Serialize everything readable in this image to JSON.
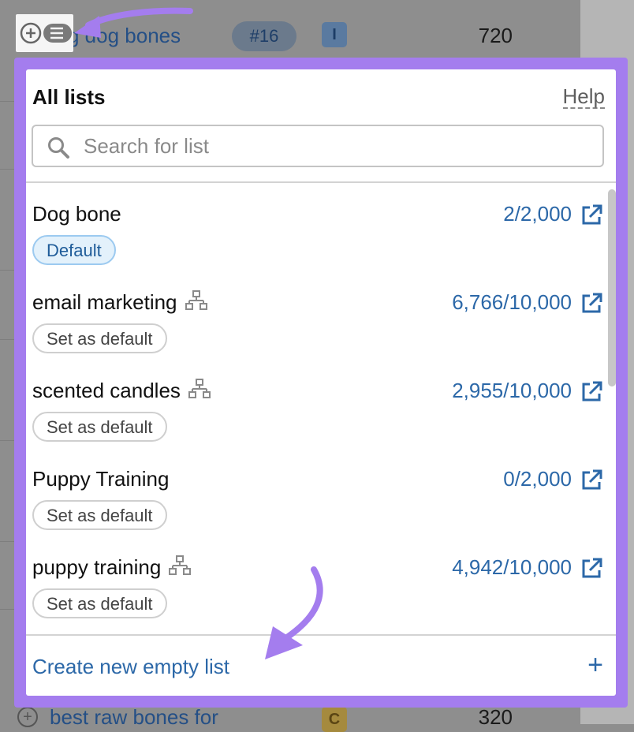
{
  "background": {
    "top_row": {
      "keyword": "g dog bones",
      "position_badge": "#16",
      "intent": "I",
      "volume": "720"
    },
    "bottom_row": {
      "keyword": "best raw bones for",
      "intent": "C",
      "volume": "320"
    }
  },
  "popup": {
    "title": "All lists",
    "help_label": "Help",
    "search": {
      "placeholder": "Search for list",
      "value": ""
    },
    "lists": [
      {
        "name": "Dog bone",
        "count": "2/2,000",
        "action": "Default",
        "is_default": true,
        "shared": false
      },
      {
        "name": "email marketing",
        "count": "6,766/10,000",
        "action": "Set as default",
        "is_default": false,
        "shared": true
      },
      {
        "name": "scented candles",
        "count": "2,955/10,000",
        "action": "Set as default",
        "is_default": false,
        "shared": true
      },
      {
        "name": "Puppy Training",
        "count": "0/2,000",
        "action": "Set as default",
        "is_default": false,
        "shared": false
      },
      {
        "name": "puppy training",
        "count": "4,942/10,000",
        "action": "Set as default",
        "is_default": false,
        "shared": true
      }
    ],
    "create_label": "Create new empty list",
    "create_plus": "+"
  },
  "colors": {
    "highlight": "#a47dee",
    "link_blue": "#2c68a8",
    "default_badge_bg": "#e3f1fb",
    "annotation_arrow": "#a47dee"
  },
  "icons": {
    "add_to_list": "plus-circle-list-icon",
    "search": "search-icon",
    "shared": "network-icon",
    "external": "external-link-icon"
  }
}
